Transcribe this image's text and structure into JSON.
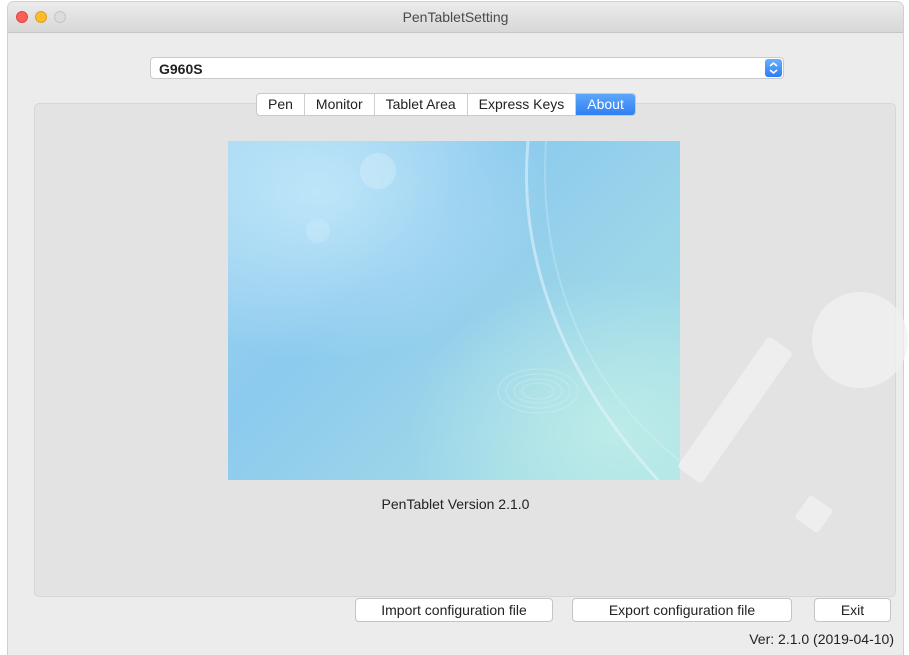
{
  "window": {
    "title": "PenTabletSetting"
  },
  "device_select": {
    "value": "G960S"
  },
  "tabs": [
    {
      "label": "Pen",
      "active": false
    },
    {
      "label": "Monitor",
      "active": false
    },
    {
      "label": "Tablet Area",
      "active": false
    },
    {
      "label": "Express Keys",
      "active": false
    },
    {
      "label": "About",
      "active": true
    }
  ],
  "about": {
    "version_text": "PenTablet Version  2.1.0"
  },
  "buttons": {
    "import_label": "Import configuration file",
    "export_label": "Export configuration file",
    "exit_label": "Exit"
  },
  "footer": {
    "version": "Ver: 2.1.0 (2019-04-10)"
  },
  "colors": {
    "accent": "#2f80f1",
    "close": "#fc5f57",
    "minimize": "#fdbc2e"
  },
  "icons": [
    "close-icon",
    "minimize-icon",
    "zoom-icon",
    "stepper-icon"
  ]
}
